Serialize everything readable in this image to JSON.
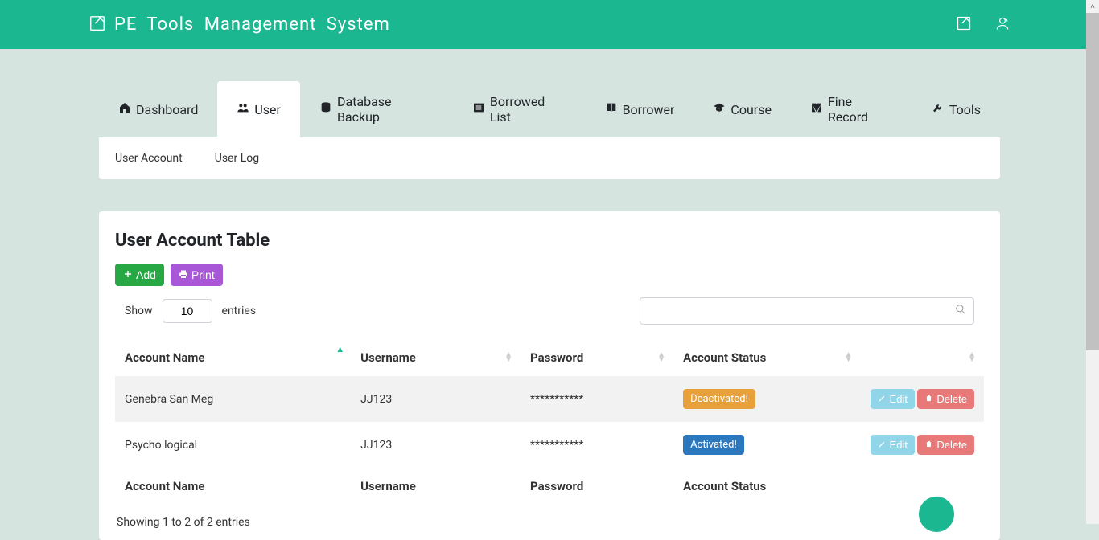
{
  "header": {
    "brand_title": "PE  Tools  Management  System"
  },
  "tabs": [
    {
      "label": "Dashboard",
      "active": false
    },
    {
      "label": "User",
      "active": true
    },
    {
      "label": "Database Backup",
      "active": false
    },
    {
      "label": "Borrowed List",
      "active": false
    },
    {
      "label": "Borrower",
      "active": false
    },
    {
      "label": "Course",
      "active": false
    },
    {
      "label": "Fine Record",
      "active": false
    },
    {
      "label": "Tools",
      "active": false
    }
  ],
  "subtabs": {
    "user_account": "User Account",
    "user_log": "User Log"
  },
  "panel": {
    "title": "User Account Table",
    "add_label": "Add",
    "print_label": "Print",
    "show_label": "Show",
    "entries_value": "10",
    "entries_label": "entries",
    "search_placeholder": ""
  },
  "columns": {
    "account_name": "Account Name",
    "username": "Username",
    "password": "Password",
    "status": "Account Status"
  },
  "status_labels": {
    "deactivated": "Deactivated!",
    "activated": "Activated!"
  },
  "action_labels": {
    "edit": "Edit",
    "delete": "Delete"
  },
  "rows": [
    {
      "name": "Genebra San Meg",
      "username": "JJ123",
      "password": "***********",
      "status": "deactivated"
    },
    {
      "name": "Psycho logical",
      "username": "JJ123",
      "password": "***********",
      "status": "activated"
    }
  ],
  "footer_info": "Showing 1 to 2 of 2 entries"
}
